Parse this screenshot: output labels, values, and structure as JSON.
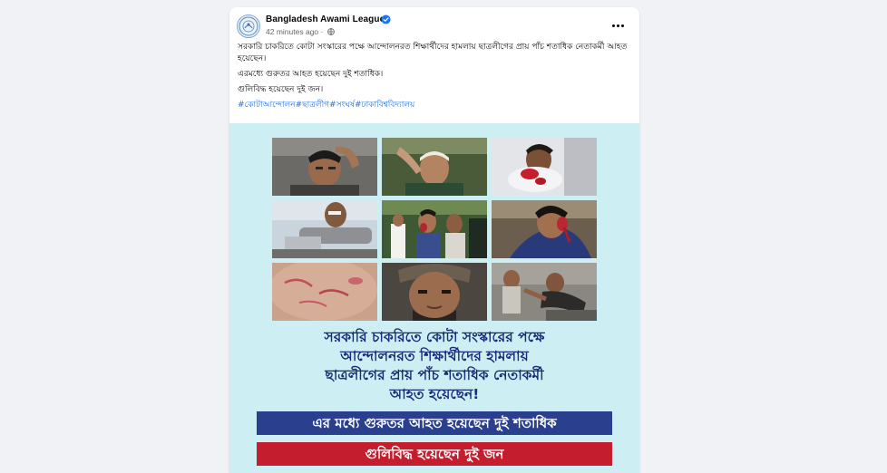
{
  "post": {
    "page_name": "Bangladesh Awami League",
    "time": "42 minutes ago",
    "separator": "·",
    "paragraphs": [
      "সরকারি চাকরিতে কোটা সংস্কারের পক্ষে আন্দোলনরত শিক্ষার্থীদের হামলায় ছাত্রলীগের প্রায় পাঁচ শতাধিক নেতাকর্মী আহত হয়েছেন।",
      "এরমধ্যে গুরুতর আহত হয়েছেন দুই শতাধিক।",
      "গুলিবিদ্ধ হয়েছেন দুই জন।"
    ],
    "hashtags": [
      "#কোটাআন্দোলন",
      "#ছাত্রলীগ",
      "#সংঘর্ষ",
      "#ঢাকাবিশ্ববিদ্যালয়"
    ]
  },
  "graphic": {
    "headline_lines": [
      "সরকারি চাকরিতে কোটা সংস্কারের পক্ষে",
      "আন্দোলনরত শিক্ষার্থীদের হামলায়",
      "ছাত্রলীগের প্রায় পাঁচ শতাধিক নেতাকর্মী",
      "আহত হয়েছেন!"
    ],
    "banner_blue": "এর মধ্যে গুরুতর আহত হয়েছেন দুই শতাধিক",
    "banner_red": "গুলিবিদ্ধ হয়েছেন দুই জন"
  },
  "icons": {
    "verified": "verified-badge-icon",
    "privacy": "globe-icon",
    "more": "more-options-icon"
  },
  "colors": {
    "page_bg": "#f0f2f5",
    "link": "#216fdb",
    "verified": "#1877f2",
    "graphic_bg": "#cdeff4",
    "headline": "#1b2b78",
    "banner_blue": "#2b3f8f",
    "banner_red": "#c41e2e"
  }
}
